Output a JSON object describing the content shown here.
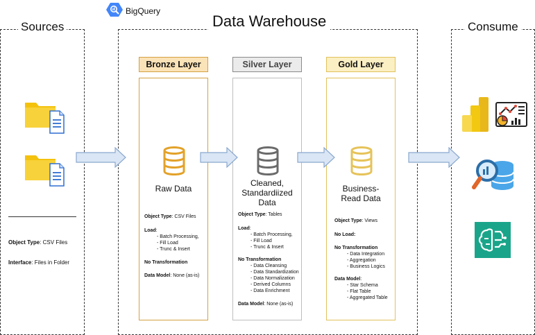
{
  "header": {
    "bigquery_label": "BigQuery",
    "title": "Data Warehouse"
  },
  "sources": {
    "title": "Sources",
    "object_type_key": "Object Type",
    "object_type_value": ": CSV Files",
    "interface_key": "Interface",
    "interface_value": ": Files in Folder"
  },
  "consume": {
    "title": "Consume"
  },
  "colors": {
    "bronze": "#d4a040",
    "bronze_fill": "#fbe3b8",
    "silver": "#8a8a8a",
    "silver_fill": "#ebebeb",
    "gold": "#e2c15a",
    "gold_fill": "#fbefc4",
    "arrow_fill": "#dae6f5",
    "arrow_stroke": "#8aa8cf"
  },
  "bronze": {
    "header": "Bronze Layer",
    "label": "Raw Data",
    "object_type_key": "Object Type",
    "object_type_value": ": CSV Files",
    "load_key": "Load",
    "load_colon": ":",
    "load_items": [
      "- Batch Processing,",
      "- Fill Load",
      "- Trunc & Insert"
    ],
    "no_transform": "No Transformation",
    "model_key": "Data Model",
    "model_value": ": None (as-is)"
  },
  "silver": {
    "header": "Silver Layer",
    "label_lines": [
      "Cleaned,",
      "Standardiized",
      "Data"
    ],
    "object_type_key": "Object Type",
    "object_type_value": ": Tables",
    "load_key": "Load",
    "load_colon": ":",
    "load_items": [
      "- Batch Processing,",
      "- Fill Load",
      "- Trunc & Insert"
    ],
    "transform_key": "No Transformation",
    "transform_items": [
      "- Data Cleansing",
      "- Data Standardization",
      "- Data Normalization",
      "- Derived Columns",
      "- Data Enrichment"
    ],
    "model_key": "Data Model",
    "model_value": ": None (as-is)"
  },
  "gold": {
    "header": "Gold Layer",
    "label_lines": [
      "Business-",
      "Read Data"
    ],
    "object_type_key": "Object Type",
    "object_type_value": ": Views",
    "no_load": "No Load:",
    "transform_key": "No Transformation",
    "transform_items": [
      "- Data Integration",
      "- Aggregation",
      "- Business Logics"
    ],
    "model_key": "Data Model",
    "model_colon": ":",
    "model_items": [
      "- Star Schema",
      "- Flat Table",
      "- Aggregated Table"
    ]
  }
}
